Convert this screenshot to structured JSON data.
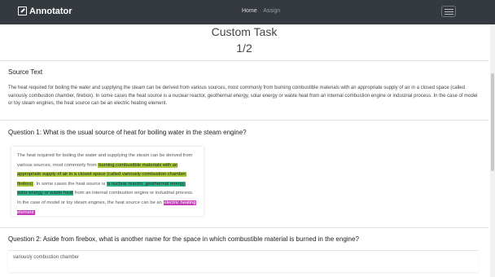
{
  "navbar": {
    "brand": "Annotator",
    "links": [
      "Home",
      "Assign"
    ]
  },
  "page": {
    "title": "Custom Task",
    "progress": "1/2"
  },
  "source": {
    "heading": "Source Text",
    "text": "The heat required for boiling the water and supplying the steam can be derived from various sources, most commonly from burning combustible materials with an appropriate supply of air in a closed space (called variously combustion chamber, firebox). In some cases the heat source is a nuclear reactor, geothermal energy, solar energy or waste heat from an internal combustion engine or industrial process. In the case of model or toy steam engines, the heat source can be an electric heating element."
  },
  "question1": {
    "label": "Question 1: What is the usual source of heat for boiling water in the steam engine?",
    "segments": [
      {
        "text": "The heat required for boiling the water and supplying the steam can be derived from various sources, most commonly from ",
        "hl": ""
      },
      {
        "text": "burning combustible materials with an appropriate supply of air in a closed space (called variously combustion chamber, firebox)",
        "hl": "a"
      },
      {
        "text": ". In some cases the heat source is ",
        "hl": ""
      },
      {
        "text": "a nuclear reactor, geothermal energy, solar energy or waste heat",
        "hl": "b"
      },
      {
        "text": " from an internal combustion engine or industrial process. In the case of model or toy steam engines, the heat source can be an ",
        "hl": ""
      },
      {
        "text": "electric heating element",
        "hl": "c"
      },
      {
        "text": ".",
        "hl": ""
      }
    ]
  },
  "question2": {
    "label": "Question 2: Aside from firebox, what is another name for the space in which combustible material is burned in the engine?",
    "answer": "variously combustion chamber"
  },
  "colors": {
    "navbar": "#343a40",
    "highlight_a": "#a6c83a",
    "highlight_b": "#2bb58a",
    "highlight_c": "#c43cb7"
  }
}
